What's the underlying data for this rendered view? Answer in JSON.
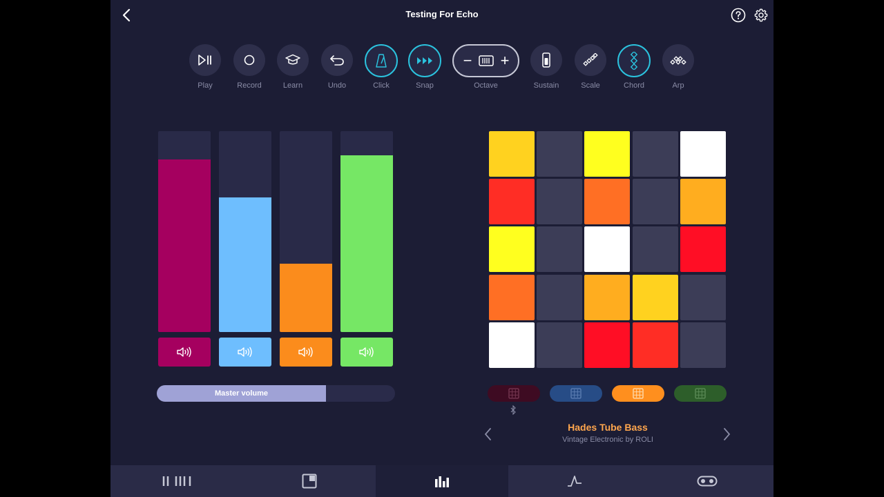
{
  "app": {
    "title": "Testing For Echo",
    "accent": "#2bc3de"
  },
  "toolbar": {
    "play": "Play",
    "record": "Record",
    "learn": "Learn",
    "undo": "Undo",
    "click": "Click",
    "snap": "Snap",
    "octave": "Octave",
    "octave_minus": "−",
    "octave_plus": "+",
    "sustain": "Sustain",
    "scale": "Scale",
    "chord": "Chord",
    "arp": "Arp",
    "active": [
      "click",
      "snap",
      "chord"
    ]
  },
  "mixer": {
    "channels": [
      {
        "color": "#a5005f",
        "level": 0.86
      },
      {
        "color": "#6ebefe",
        "level": 0.67
      },
      {
        "color": "#fb8c1c",
        "level": 0.34
      },
      {
        "color": "#76e765",
        "level": 0.88
      }
    ],
    "master_label": "Master volume",
    "master_level": 0.71
  },
  "pad_grid": {
    "rows": [
      [
        "#ffd21f",
        "#3c3d57",
        "#ffff1f",
        "#3c3d57",
        "#ffffff"
      ],
      [
        "#ff2d25",
        "#3c3d57",
        "#ff6f24",
        "#3c3d57",
        "#ffad1f"
      ],
      [
        "#ffff1f",
        "#3c3d57",
        "#ffffff",
        "#3c3d57",
        "#ff0e25"
      ],
      [
        "#ff6f24",
        "#3c3d57",
        "#ffad1f",
        "#ffd21f",
        "#3c3d57"
      ],
      [
        "#ffffff",
        "#3c3d57",
        "#ff0e25",
        "#ff2d25",
        "#3c3d57"
      ]
    ]
  },
  "banks": [
    {
      "color": "#3e0b22",
      "icon_color": "#7a3a55"
    },
    {
      "color": "#274c86",
      "icon_color": "#5f80b5"
    },
    {
      "color": "#ff8f1e",
      "icon_color": "#ffe0b8",
      "active": true
    },
    {
      "color": "#2d5e2a",
      "icon_color": "#5f8e5a"
    }
  ],
  "sound": {
    "name": "Hades Tube Bass",
    "subtitle": "Vintage Electronic by ROLI"
  },
  "bottom_nav": {
    "tabs": [
      "keyboard-icon",
      "pad-layout-icon",
      "mixer-icon",
      "envelope-icon",
      "toggle-icon"
    ],
    "active_index": 2
  }
}
